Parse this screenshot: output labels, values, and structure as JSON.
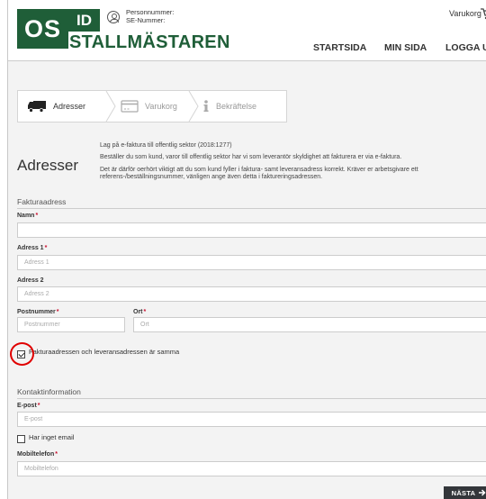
{
  "header": {
    "logo_os": "OS",
    "logo_id": "ID",
    "personnummer": "Personnummer:",
    "se_nummer": "SE-Nummer:",
    "brand": "STALLMÄSTAREN",
    "cart": "Varukorg",
    "nav": [
      "STARTSIDA",
      "MIN SIDA",
      "LOGGA UT"
    ],
    "brand_color": "#1f5e38"
  },
  "stepper": {
    "steps": [
      {
        "label": "Adresser",
        "icon": "truck-icon",
        "active": true
      },
      {
        "label": "Varukorg",
        "icon": "credit-card-icon",
        "active": false
      },
      {
        "label": "Bekräftelse",
        "icon": "info-icon",
        "active": false
      }
    ]
  },
  "intro": {
    "line1": "Lag på e-faktura till offentlig sektor (2018:1277)",
    "line2": "Beställer du som kund, varor till offentlig sektor har vi som leverantör skyldighet att fakturera er via e-faktura.",
    "line3": "Det är därför oerhört viktigt att du som kund fyller i faktura- samt leveransadress korrekt. Kräver er arbetsgivare ett",
    "line4": "referens-/beställningsnummer, vänligen ange även detta i faktureringsadressen."
  },
  "page_title": "Adresser",
  "billing": {
    "section": "Fakturaadress",
    "name_label": "Namn",
    "name_value": "",
    "address1_label": "Adress 1",
    "address1_placeholder": "Adress 1",
    "address2_label": "Adress 2",
    "address2_placeholder": "Adress 2",
    "postal_label": "Postnummer",
    "postal_placeholder": "Postnummer",
    "city_label": "Ort",
    "city_placeholder": "Ort",
    "same_address_label": "Fakturaadressen och leveransadressen är samma",
    "same_address_checked": true
  },
  "contact": {
    "section": "Kontaktinformation",
    "email_label": "E-post",
    "email_placeholder": "E-post",
    "no_email_label": "Har inget email",
    "no_email_checked": false,
    "mobile_label": "Mobiltelefon",
    "mobile_placeholder": "Mobiltelefon"
  },
  "next_button": "NÄSTA",
  "required_marker": "*",
  "required_color": "#c8102e",
  "annotation_color": "#e00000"
}
